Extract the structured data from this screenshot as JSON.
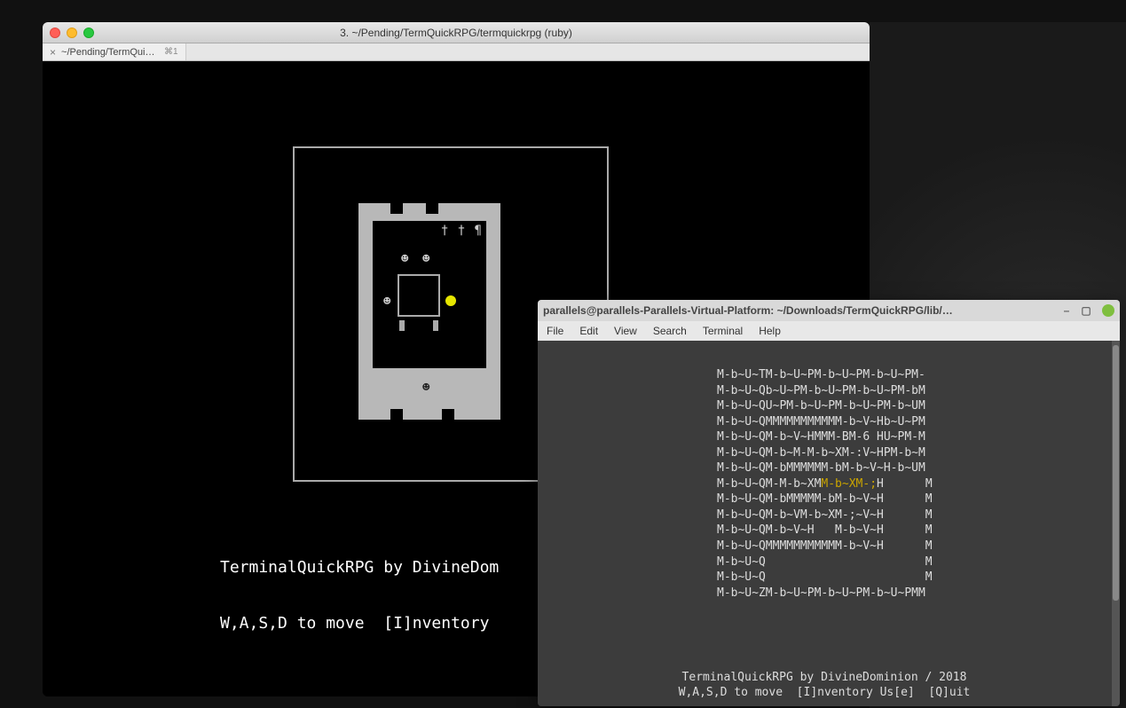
{
  "mac": {
    "title": "3. ~/Pending/TermQuickRPG/termquickrpg (ruby)",
    "tab": {
      "close": "×",
      "label": "~/Pending/TermQuic…",
      "shortcut": "⌘1"
    },
    "game": {
      "glyphs_top_right": "† † ¶",
      "faces": {
        "f1": "☻",
        "f2": "☻",
        "f3": "☻"
      },
      "floor_face": "☻"
    },
    "status_line1": "TerminalQuickRPG by DivineDom",
    "status_line2": "W,A,S,D to move  [I]nventory "
  },
  "linux": {
    "title": "parallels@parallels-Parallels-Virtual-Platform: ~/Downloads/TermQuickRPG/lib/…",
    "window_buttons": {
      "min": "–",
      "max": "▢"
    },
    "menu": [
      "File",
      "Edit",
      "View",
      "Search",
      "Terminal",
      "Help"
    ],
    "map_lines": [
      "M-b~U~TM-b~U~PM-b~U~PM-b~U~PM-",
      "M-b~U~Qb~U~PM-b~U~PM-b~U~PM-bM",
      "M-b~U~QU~PM-b~U~PM-b~U~PM-b~UM",
      "M-b~U~QMMMMMMMMMMM-b~V~Hb~U~PM",
      "M-b~U~QM-b~V~HMMM-BM-6 HU~PM-M",
      "M-b~U~QM-b~M-M-b~XM-:V~HPM-b~M",
      "M-b~U~QM-bMMMMMM-bM-b~V~H-b~UM"
    ],
    "map_line_hl_prefix": "M-b~U~QM-M-b~XM",
    "map_line_hl_mid": "M-b~XM-;",
    "map_line_hl_suffix": "H      M",
    "map_lines_after": [
      "M-b~U~QM-bMMMMM-bM-b~V~H      M",
      "M-b~U~QM-b~VM-b~XM-;~V~H      M",
      "M-b~U~QM-b~V~H   M-b~V~H      M",
      "M-b~U~QMMMMMMMMMMM-b~V~H      M",
      "M-b~U~Q                       M",
      "M-b~U~Q                       M",
      "M-b~U~ZM-b~U~PM-b~U~PM-b~U~PMM"
    ],
    "status_line1": "TerminalQuickRPG by DivineDominion / 2018",
    "status_line2": "W,A,S,D to move  [I]nventory Us[e]  [Q]uit"
  }
}
